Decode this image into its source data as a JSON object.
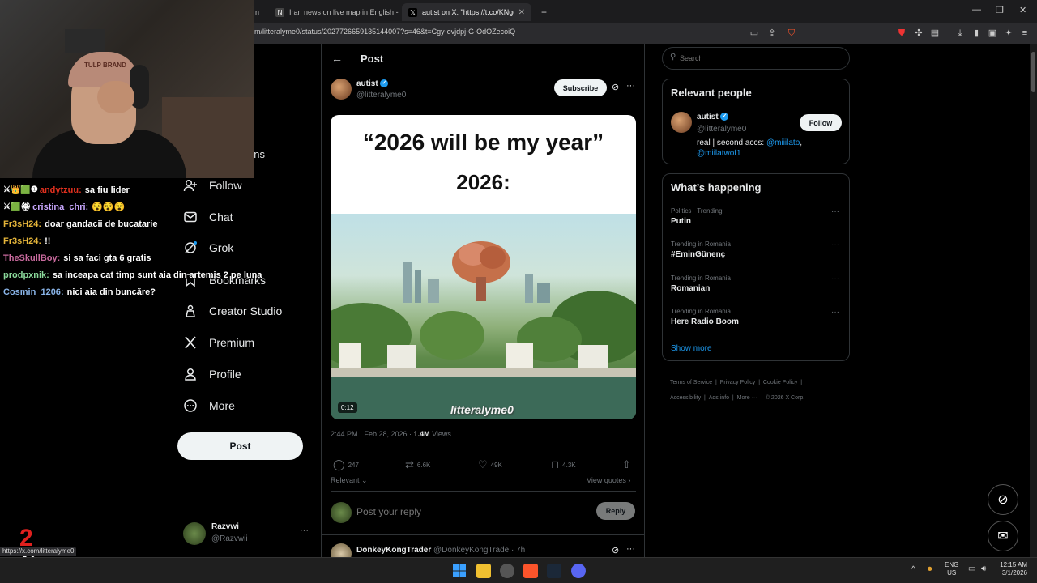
{
  "browser": {
    "tabs": [
      {
        "label": "n",
        "active": false
      },
      {
        "label": "Iran news on live map in English - Co",
        "active": false
      },
      {
        "label": "autist on X: \"https://t.co/KNgo6",
        "active": true
      }
    ],
    "new_tab": "+",
    "url": "m/litteralyme0/status/2027726659135144007?s=46&t=Cgy-ovjdpj-G-OdOZecoiQ",
    "status_url": "https://x.com/litteralyme0"
  },
  "webcam": {
    "cap_text": "TULP BRAND"
  },
  "chat": [
    {
      "badges": "⚔👑🟩❶",
      "user": "andytzuu",
      "user_color": "#e0301e",
      "text": "sa fiu lider"
    },
    {
      "badges": "⚔🟩🏵",
      "user": "cristina_chri",
      "user_color": "#c9a8ff",
      "text": "😵😵😵"
    },
    {
      "badges": "",
      "user": "Fr3sH24",
      "user_color": "#e5b53a",
      "text": "doar gandacii de bucatarie"
    },
    {
      "badges": "",
      "user": "Fr3sH24",
      "user_color": "#e5b53a",
      "text": "!!"
    },
    {
      "badges": "",
      "user": "TheSkullBoy",
      "user_color": "#c96a9e",
      "text": "si sa faci gta 6 gratis"
    },
    {
      "badges": "",
      "user": "prodpxnik",
      "user_color": "#8bd99b",
      "text": "sa inceapa cat timp sunt aia din artemis 2 pe luna"
    },
    {
      "badges": "",
      "user": "Cosmin_1206",
      "user_color": "#89b4e8",
      "text": "nici aia din buncăre?"
    }
  ],
  "overlay_badge": "x2",
  "nav": {
    "partial_label": "ons",
    "items": [
      {
        "label": "Follow",
        "icon": "follow-icon"
      },
      {
        "label": "Chat",
        "icon": "chat-icon"
      },
      {
        "label": "Grok",
        "icon": "grok-icon"
      },
      {
        "label": "Bookmarks",
        "icon": "bookmark-icon"
      },
      {
        "label": "Creator Studio",
        "icon": "creator-icon"
      },
      {
        "label": "Premium",
        "icon": "x-icon"
      },
      {
        "label": "Profile",
        "icon": "profile-icon"
      },
      {
        "label": "More",
        "icon": "more-icon"
      }
    ],
    "post_button": "Post",
    "account": {
      "name": "Razvwi",
      "handle": "@Razvwii"
    }
  },
  "post": {
    "header_title": "Post",
    "author": {
      "name": "autist",
      "handle": "@litteralyme0"
    },
    "subscribe": "Subscribe",
    "meme_line1": "“2026 will be my year”",
    "meme_line2": "2026:",
    "video_duration": "0:12",
    "watermark": "litteralyme0",
    "time": "2:44 PM · Feb 28, 2026 · ",
    "views_count": "1.4M",
    "views_label": " Views",
    "stats": {
      "replies": "247",
      "reposts": "6.6K",
      "likes": "49K",
      "bookmarks": "4.3K"
    },
    "sort": "Relevant",
    "view_quotes": "View quotes",
    "reply_placeholder": "Post your reply",
    "reply_button": "Reply",
    "next_reply": {
      "name": "DonkeyKongTrader",
      "handle": "@DonkeyKongTrade",
      "age": "· 7h"
    }
  },
  "sidebar": {
    "search_placeholder": "Search",
    "relevant": {
      "title": "Relevant people",
      "name": "autist",
      "handle": "@litteralyme0",
      "follow": "Follow",
      "bio": "real | second accs: ",
      "link1": "@miiilato",
      "sep": ",",
      "link2": "@miilatwof1"
    },
    "happening": {
      "title": "What’s happening",
      "trends": [
        {
          "context": "Politics · Trending",
          "topic": "Putin"
        },
        {
          "context": "Trending in Romania",
          "topic": "#EminGünenç"
        },
        {
          "context": "Trending in Romania",
          "topic": "Romanian"
        },
        {
          "context": "Trending in Romania",
          "topic": "Here Radio Boom"
        }
      ],
      "show_more": "Show more"
    },
    "footer": [
      "Terms of Service",
      "Privacy Policy",
      "Cookie Policy",
      "Accessibility",
      "Ads info",
      "More ···",
      "© 2026 X Corp."
    ]
  },
  "tray": {
    "lang1": "ENG",
    "lang2": "US",
    "time": "12:15 AM",
    "date": "3/1/2026"
  },
  "colors": {
    "accent": "#1d9bf0",
    "link": "#1d9bf0"
  }
}
